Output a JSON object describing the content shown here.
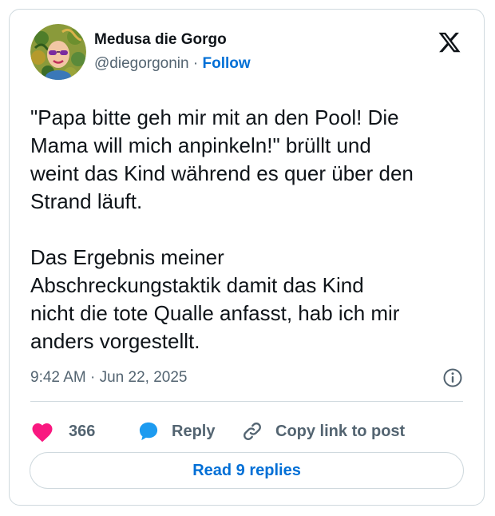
{
  "author": {
    "display_name": "Medusa die Gorgo",
    "handle": "@diegorgonin",
    "separator": "·",
    "follow_label": "Follow"
  },
  "tweet": {
    "text": "\"Papa bitte geh mir mit an den Pool! Die\nMama will mich anpinkeln!\" brüllt und\nweint das Kind während es quer über den\nStrand läuft.\n\nDas Ergebnis meiner\nAbschreckungstaktik damit das Kind\nnicht die tote Qualle anfasst, hab ich mir\nanders vorgestellt.",
    "timestamp": "9:42 AM · Jun 22, 2025"
  },
  "actions": {
    "like_count": "366",
    "reply_label": "Reply",
    "copy_link_label": "Copy link to post"
  },
  "read_replies_label": "Read 9 replies",
  "colors": {
    "accent": "#006fd6",
    "like": "#f91880",
    "reply": "#1d9bf0",
    "text": "#0f1419",
    "muted": "#536471",
    "border": "#cfd9de"
  },
  "icons": {
    "logo": "x-logo-icon",
    "info": "info-icon",
    "like": "heart-icon",
    "reply": "speech-bubble-icon",
    "copy": "link-icon"
  }
}
